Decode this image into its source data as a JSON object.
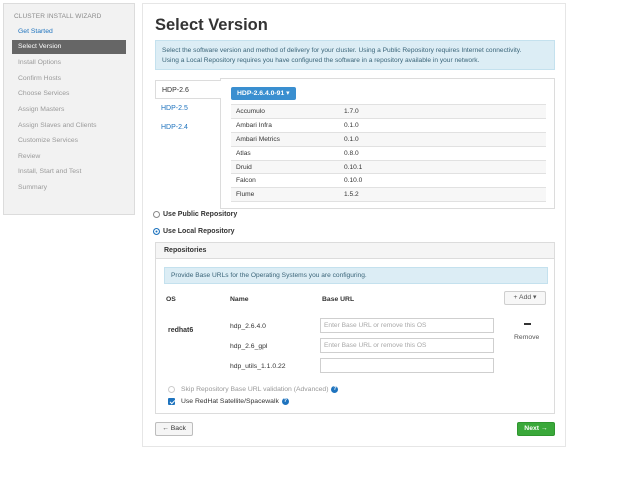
{
  "sidebar": {
    "header": "CLUSTER INSTALL WIZARD",
    "items": [
      {
        "label": "Get Started"
      },
      {
        "label": "Select Version"
      },
      {
        "label": "Install Options"
      },
      {
        "label": "Confirm Hosts"
      },
      {
        "label": "Choose Services"
      },
      {
        "label": "Assign Masters"
      },
      {
        "label": "Assign Slaves and Clients"
      },
      {
        "label": "Customize Services"
      },
      {
        "label": "Review"
      },
      {
        "label": "Install, Start and Test"
      },
      {
        "label": "Summary"
      }
    ]
  },
  "main": {
    "title": "Select Version",
    "info_line1": "Select the software version and method of delivery for your cluster. Using a Public Repository requires Internet connectivity.",
    "info_line2": "Using a Local Repository requires you have configured the software in a repository available in your network."
  },
  "stacks": {
    "tabs": [
      {
        "label": "HDP-2.6"
      },
      {
        "label": "HDP-2.5"
      },
      {
        "label": "HDP-2.4"
      }
    ],
    "version_button": "HDP-2.6.4.0-91",
    "services": [
      {
        "name": "Accumulo",
        "version": "1.7.0"
      },
      {
        "name": "Ambari Infra",
        "version": "0.1.0"
      },
      {
        "name": "Ambari Metrics",
        "version": "0.1.0"
      },
      {
        "name": "Atlas",
        "version": "0.8.0"
      },
      {
        "name": "Druid",
        "version": "0.10.1"
      },
      {
        "name": "Falcon",
        "version": "0.10.0"
      },
      {
        "name": "Flume",
        "version": "1.5.2"
      }
    ]
  },
  "delivery": {
    "public_label": "Use Public Repository",
    "local_label": "Use Local Repository"
  },
  "repositories": {
    "header": "Repositories",
    "info": "Provide Base URLs for the Operating Systems you are configuring.",
    "col_os": "OS",
    "col_name": "Name",
    "col_url": "Base URL",
    "add_label": "+ Add",
    "os": "redhat6",
    "remove_label": "Remove",
    "rows": [
      {
        "name": "hdp_2.6.4.0",
        "placeholder": "Enter Base URL or remove this OS"
      },
      {
        "name": "hdp_2.6_gpl",
        "placeholder": "Enter Base URL or remove this OS"
      },
      {
        "name": "hdp_utils_1.1.0.22",
        "placeholder": ""
      }
    ],
    "skip_label": "Skip Repository Base URL validation (Advanced)",
    "satellite_label": "Use RedHat Satellite/Spacewalk"
  },
  "footer": {
    "back": "← Back",
    "next": "Next →"
  },
  "colors": {
    "accent": "#1e73be",
    "primary_button": "#3a8fd0",
    "success": "#3aa83a",
    "info_bg": "#dcedf5"
  }
}
